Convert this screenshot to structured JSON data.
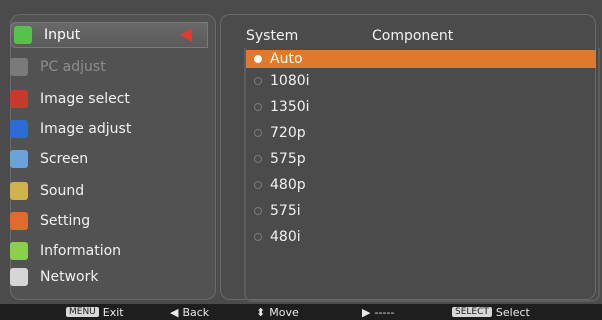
{
  "menu": {
    "items": [
      {
        "label": "Input",
        "name": "menu-item-input",
        "state": "selected",
        "icon": "input-icon",
        "color": "#55c24a"
      },
      {
        "label": "PC adjust",
        "name": "menu-item-pc-adjust",
        "state": "disabled",
        "icon": "pc-adjust-icon",
        "color": "#7a7a7a"
      },
      {
        "label": "Image select",
        "name": "menu-item-image-select",
        "state": "normal",
        "icon": "image-select-icon",
        "color": "#c43b2c"
      },
      {
        "label": "Image adjust",
        "name": "menu-item-image-adjust",
        "state": "normal",
        "icon": "image-adjust-icon",
        "color": "#2b6bd6"
      },
      {
        "label": "Screen",
        "name": "menu-item-screen",
        "state": "normal",
        "icon": "screen-icon",
        "color": "#6aa3d9"
      },
      {
        "label": "Sound",
        "name": "menu-item-sound",
        "state": "normal",
        "icon": "sound-icon",
        "color": "#d0b24a"
      },
      {
        "label": "Setting",
        "name": "menu-item-setting",
        "state": "normal",
        "icon": "setting-icon",
        "color": "#e16b2c"
      },
      {
        "label": "Information",
        "name": "menu-item-information",
        "state": "normal",
        "icon": "information-icon",
        "color": "#8bd04a"
      },
      {
        "label": "Network",
        "name": "menu-item-network",
        "state": "normal",
        "icon": "network-icon",
        "color": "#d6d6d6"
      }
    ]
  },
  "right": {
    "header": {
      "col1": "System",
      "col2": "Component"
    },
    "options": [
      {
        "label": "Auto",
        "selected": true
      },
      {
        "label": "1080i",
        "selected": false
      },
      {
        "label": "1350i",
        "selected": false
      },
      {
        "label": "720p",
        "selected": false
      },
      {
        "label": "575p",
        "selected": false
      },
      {
        "label": "480p",
        "selected": false
      },
      {
        "label": "575i",
        "selected": false
      },
      {
        "label": "480i",
        "selected": false
      }
    ]
  },
  "bottom": {
    "exit": {
      "key": "MENU",
      "label": "Exit"
    },
    "back": {
      "symbol": "◀",
      "label": "Back"
    },
    "move": {
      "symbol": "⬍",
      "label": "Move"
    },
    "forward": {
      "symbol": "▶",
      "label": "-----"
    },
    "select": {
      "key": "SELECT",
      "label": "Select"
    }
  }
}
